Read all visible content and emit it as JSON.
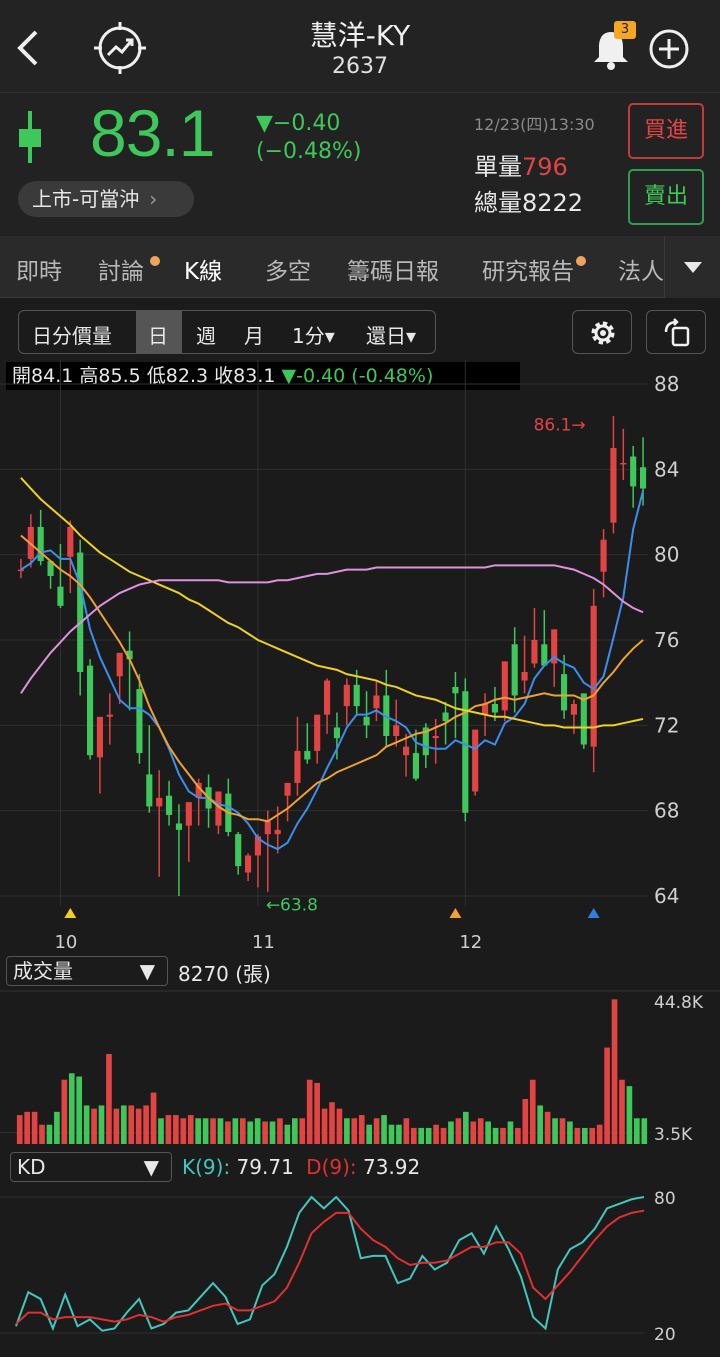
{
  "header": {
    "title": "慧洋-KY",
    "code": "2637",
    "notification_count": "3"
  },
  "quote": {
    "price": "83.1",
    "change": "▼−0.40",
    "change_pct": "(−0.48%)",
    "timestamp": "12/23(四)13:30",
    "unit_volume_label": "單量",
    "unit_volume": "796",
    "total_volume_label": "總量",
    "total_volume": "8222",
    "board_label": "上市-可當沖",
    "buy_label": "買進",
    "sell_label": "賣出",
    "up_color": "#e24444",
    "down_color": "#3ec75a"
  },
  "tabs": [
    "即時",
    "討論",
    "K線",
    "多空",
    "籌碼日報",
    "研究報告",
    "法人"
  ],
  "active_tab": "K線",
  "toolbar": {
    "items": [
      "日分價量",
      "日",
      "週",
      "月",
      "1分▾",
      "還日▾"
    ],
    "active": "日"
  },
  "ohlc": {
    "open_label": "開",
    "open": "84.1",
    "high_label": "高",
    "high": "85.5",
    "low_label": "低",
    "low": "82.3",
    "close_label": "收",
    "close": "83.1",
    "change": "▼-0.40 (-0.48%)"
  },
  "volume_panel": {
    "indicator": "成交量",
    "value": "8270 (張)"
  },
  "kd_panel": {
    "indicator": "KD",
    "k_label": "K(9):",
    "k_value": "79.71",
    "d_label": "D(9):",
    "d_value": "73.92"
  },
  "chart_data": [
    {
      "type": "candlestick",
      "y_ticks": [
        "88",
        "84",
        "80",
        "76",
        "72",
        "68",
        "64"
      ],
      "ylim": [
        64,
        88
      ],
      "x_labels": [
        {
          "label": "10",
          "index": 4
        },
        {
          "label": "11",
          "index": 24
        },
        {
          "label": "12",
          "index": 45
        }
      ],
      "annotations": [
        {
          "text": "86.1→",
          "index": 59,
          "value": 86.1
        },
        {
          "text": "←63.8",
          "index": 25,
          "value": 63.8
        }
      ],
      "markers": [
        {
          "index": 5,
          "color": "#f0d020"
        },
        {
          "index": 44,
          "color": "#f0a030"
        },
        {
          "index": 58,
          "color": "#2f7fe0"
        }
      ],
      "ohlc": [
        [
          79.3,
          79.8,
          78.9,
          79.3
        ],
        [
          79.8,
          81.9,
          79.4,
          81.3
        ],
        [
          81.3,
          82.1,
          79.5,
          79.7
        ],
        [
          79.7,
          79.7,
          78.4,
          79.0
        ],
        [
          78.5,
          80.5,
          77.5,
          77.6
        ],
        [
          79.9,
          81.6,
          78.2,
          81.3
        ],
        [
          80.1,
          80.7,
          73.4,
          74.5
        ],
        [
          74.8,
          75.1,
          70.4,
          70.6
        ],
        [
          70.5,
          72.3,
          68.8,
          72.4
        ],
        [
          72.4,
          73.5,
          71.1,
          72.5
        ],
        [
          74.3,
          75.3,
          73.0,
          75.4
        ],
        [
          75.5,
          76.4,
          72.7,
          75.1
        ],
        [
          73.7,
          74.4,
          70.2,
          70.7
        ],
        [
          69.7,
          72.0,
          67.9,
          68.2
        ],
        [
          68.2,
          69.9,
          64.9,
          68.6
        ],
        [
          68.7,
          69.4,
          67.3,
          67.8
        ],
        [
          67.4,
          68.3,
          64.0,
          67.1
        ],
        [
          67.3,
          68.3,
          65.6,
          68.4
        ],
        [
          68.6,
          69.5,
          67.3,
          69.3
        ],
        [
          69.1,
          69.7,
          67.2,
          68.1
        ],
        [
          67.3,
          68.7,
          66.9,
          68.9
        ],
        [
          68.8,
          69.5,
          66.8,
          67.0
        ],
        [
          66.9,
          67.0,
          65.0,
          65.4
        ],
        [
          65.1,
          66.0,
          64.7,
          65.9
        ],
        [
          65.9,
          66.9,
          64.4,
          66.8
        ],
        [
          66.9,
          68.0,
          64.2,
          67.5
        ],
        [
          66.9,
          68.2,
          66.0,
          67.1
        ],
        [
          68.7,
          69.3,
          67.5,
          69.3
        ],
        [
          69.3,
          72.4,
          68.7,
          70.8
        ],
        [
          70.8,
          72.1,
          70.2,
          70.4
        ],
        [
          70.8,
          72.1,
          70.2,
          72.5
        ],
        [
          72.5,
          74.2,
          71.6,
          74.1
        ],
        [
          71.9,
          72.6,
          70.4,
          71.4
        ],
        [
          72.9,
          74.2,
          72.0,
          73.9
        ],
        [
          73.9,
          74.6,
          72.5,
          72.9
        ],
        [
          72.4,
          73.6,
          71.4,
          72.0
        ],
        [
          72.8,
          74.1,
          72.2,
          73.4
        ],
        [
          73.4,
          74.6,
          71.0,
          71.5
        ],
        [
          71.5,
          73.2,
          71.0,
          72.0
        ],
        [
          70.6,
          71.6,
          69.6,
          71.0
        ],
        [
          70.7,
          71.8,
          69.4,
          69.5
        ],
        [
          71.9,
          72.1,
          70.0,
          70.6
        ],
        [
          71.4,
          72.3,
          70.2,
          71.5
        ],
        [
          72.6,
          73.1,
          71.1,
          72.2
        ],
        [
          73.8,
          74.5,
          71.4,
          73.5
        ],
        [
          73.6,
          74.2,
          67.5,
          67.9
        ],
        [
          68.9,
          71.6,
          68.7,
          71.8
        ],
        [
          72.5,
          73.5,
          71.5,
          73.0
        ],
        [
          73.0,
          73.8,
          72.2,
          72.6
        ],
        [
          72.7,
          74.2,
          72.2,
          75.0
        ],
        [
          75.8,
          76.6,
          72.6,
          73.4
        ],
        [
          74.1,
          76.2,
          73.5,
          74.5
        ],
        [
          74.9,
          77.5,
          74.7,
          76.0
        ],
        [
          75.8,
          77.4,
          74.8,
          74.8
        ],
        [
          74.9,
          76.4,
          73.8,
          76.5
        ],
        [
          74.4,
          75.3,
          72.3,
          72.7
        ],
        [
          72.5,
          73.2,
          71.6,
          73.0
        ],
        [
          73.5,
          73.5,
          70.9,
          71.1
        ],
        [
          71.0,
          78.4,
          69.8,
          77.6
        ],
        [
          79.2,
          81.2,
          78.0,
          80.7
        ],
        [
          81.5,
          86.5,
          81.0,
          85.0
        ],
        [
          84.3,
          85.9,
          83.5,
          84.3
        ],
        [
          84.6,
          85.1,
          82.2,
          83.2
        ],
        [
          84.1,
          85.5,
          82.3,
          83.1
        ]
      ],
      "ma_lines": [
        {
          "color": "#3a8ef0",
          "values": [
            79.3,
            79.6,
            80.1,
            80.2,
            79.8,
            79.8,
            78.6,
            76.5,
            75.2,
            74.2,
            73.2,
            72.8,
            72.8,
            72.5,
            71.9,
            70.9,
            69.7,
            68.9,
            68.6,
            68.6,
            68.3,
            68.2,
            67.9,
            67.4,
            66.7,
            66.4,
            66.2,
            66.5,
            67.4,
            68.1,
            69.0,
            70.0,
            70.9,
            71.9,
            72.5,
            72.5,
            72.7,
            72.4,
            72.2,
            71.9,
            71.2,
            71.0,
            70.9,
            70.9,
            71.3,
            71.1,
            70.9,
            71.3,
            71.1,
            72.1,
            72.4,
            73.0,
            74.2,
            74.8,
            75.2,
            74.9,
            74.7,
            74.0,
            73.7,
            74.3,
            76.1,
            78.0,
            81.2,
            83.0
          ]
        },
        {
          "color": "#f0a030",
          "values": [
            80.9,
            80.5,
            80.1,
            79.7,
            79.3,
            79.0,
            78.6,
            78.0,
            77.3,
            76.6,
            75.9,
            75.1,
            74.1,
            72.9,
            71.9,
            71.0,
            70.3,
            69.7,
            69.1,
            68.6,
            68.2,
            67.9,
            67.8,
            67.6,
            67.6,
            67.5,
            67.8,
            68.1,
            68.5,
            68.9,
            69.3,
            69.5,
            69.8,
            70.0,
            70.2,
            70.4,
            70.6,
            71.0,
            71.2,
            71.4,
            71.6,
            71.7,
            71.9,
            72.1,
            72.4,
            72.6,
            72.9,
            73.0,
            73.2,
            73.3,
            73.2,
            73.3,
            73.4,
            73.5,
            73.4,
            73.4,
            73.4,
            73.2,
            73.4,
            74.0,
            74.5,
            75.1,
            75.6,
            76.0
          ]
        },
        {
          "color": "#f0d020",
          "values": [
            83.6,
            83.1,
            82.6,
            82.2,
            81.8,
            81.4,
            80.9,
            80.5,
            80.1,
            79.8,
            79.5,
            79.2,
            79.0,
            78.8,
            78.6,
            78.4,
            78.2,
            77.9,
            77.7,
            77.4,
            77.1,
            76.8,
            76.6,
            76.3,
            76.0,
            75.8,
            75.6,
            75.4,
            75.2,
            75.0,
            74.8,
            74.7,
            74.6,
            74.4,
            74.3,
            74.2,
            74.1,
            73.9,
            73.8,
            73.6,
            73.4,
            73.3,
            73.2,
            73.0,
            72.8,
            72.7,
            72.6,
            72.5,
            72.4,
            72.4,
            72.3,
            72.2,
            72.1,
            72.0,
            72.0,
            71.9,
            71.9,
            71.9,
            71.9,
            72.0,
            72.0,
            72.1,
            72.2,
            72.3
          ]
        },
        {
          "color": "#e090e0",
          "values": [
            73.5,
            74.2,
            74.8,
            75.4,
            75.9,
            76.4,
            76.8,
            77.2,
            77.6,
            77.9,
            78.2,
            78.4,
            78.6,
            78.7,
            78.8,
            78.8,
            78.8,
            78.8,
            78.8,
            78.8,
            78.8,
            78.7,
            78.7,
            78.7,
            78.7,
            78.7,
            78.8,
            78.8,
            78.9,
            79.0,
            79.1,
            79.1,
            79.2,
            79.3,
            79.3,
            79.3,
            79.4,
            79.4,
            79.4,
            79.4,
            79.4,
            79.4,
            79.4,
            79.4,
            79.4,
            79.4,
            79.4,
            79.4,
            79.5,
            79.5,
            79.5,
            79.5,
            79.5,
            79.5,
            79.5,
            79.4,
            79.3,
            79.1,
            78.9,
            78.6,
            78.2,
            77.8,
            77.5,
            77.3
          ]
        }
      ]
    },
    {
      "type": "bar",
      "name": "volume",
      "y_ticks": [
        "44.8K",
        "3.5K"
      ],
      "ylim": [
        0,
        44.8
      ],
      "values": [
        9,
        10,
        10,
        6,
        6,
        10,
        20,
        22,
        21,
        12,
        11,
        12,
        28,
        11,
        12,
        12,
        11,
        12,
        16,
        8,
        9,
        9,
        8,
        9,
        8,
        8,
        8,
        8,
        7,
        8,
        8,
        7,
        8,
        7,
        7,
        8,
        6,
        8,
        8,
        20,
        19,
        11,
        13,
        11,
        8,
        8,
        9,
        6,
        8,
        9,
        6,
        6,
        8,
        5,
        5,
        5,
        6,
        5,
        7,
        8,
        10,
        7,
        8,
        7,
        5,
        5,
        7,
        5,
        14,
        20,
        12,
        10,
        8,
        8,
        7,
        5,
        5,
        5,
        6,
        30,
        45,
        20,
        18,
        8,
        8
      ],
      "up": [
        1,
        1,
        1,
        1,
        0,
        0,
        1,
        0,
        0,
        0,
        1,
        0,
        1,
        1,
        0,
        1,
        1,
        1,
        1,
        0,
        1,
        1,
        1,
        1,
        0,
        0,
        1,
        0,
        1,
        0,
        1,
        0,
        0,
        1,
        0,
        1,
        0,
        0,
        1,
        1,
        1,
        1,
        1,
        1,
        0,
        1,
        1,
        0,
        1,
        0,
        0,
        0,
        1,
        1,
        0,
        0,
        1,
        1,
        0,
        1,
        0,
        1,
        1,
        0,
        0,
        1,
        0,
        1,
        1,
        1,
        0,
        1,
        0,
        1,
        0,
        1,
        0,
        1,
        1,
        1,
        1,
        1,
        0,
        0,
        0
      ]
    },
    {
      "type": "line",
      "name": "KD",
      "y_ticks": [
        "80",
        "20"
      ],
      "ylim": [
        20,
        80
      ],
      "series": [
        {
          "name": "K(9)",
          "color": "#40c8c0",
          "values": [
            23,
            38,
            35,
            22,
            37,
            23,
            26,
            21,
            22,
            29,
            35,
            22,
            24,
            29,
            30,
            36,
            42,
            36,
            24,
            26,
            41,
            46,
            58,
            73,
            80,
            75,
            80,
            74,
            53,
            54,
            54,
            42,
            44,
            54,
            48,
            51,
            61,
            64,
            55,
            67,
            57,
            45,
            27,
            22,
            48,
            57,
            60,
            66,
            75,
            77,
            79,
            80
          ]
        },
        {
          "name": "D(9)",
          "color": "#e03030",
          "values": [
            24,
            29,
            29,
            26,
            27,
            27,
            27,
            26,
            25,
            26,
            28,
            27,
            25,
            27,
            28,
            30,
            32,
            33,
            30,
            30,
            32,
            34,
            40,
            51,
            64,
            69,
            73,
            73,
            66,
            61,
            58,
            53,
            50,
            51,
            51,
            52,
            55,
            58,
            58,
            60,
            60,
            55,
            40,
            35,
            41,
            47,
            54,
            61,
            67,
            71,
            73,
            74
          ]
        }
      ]
    }
  ]
}
